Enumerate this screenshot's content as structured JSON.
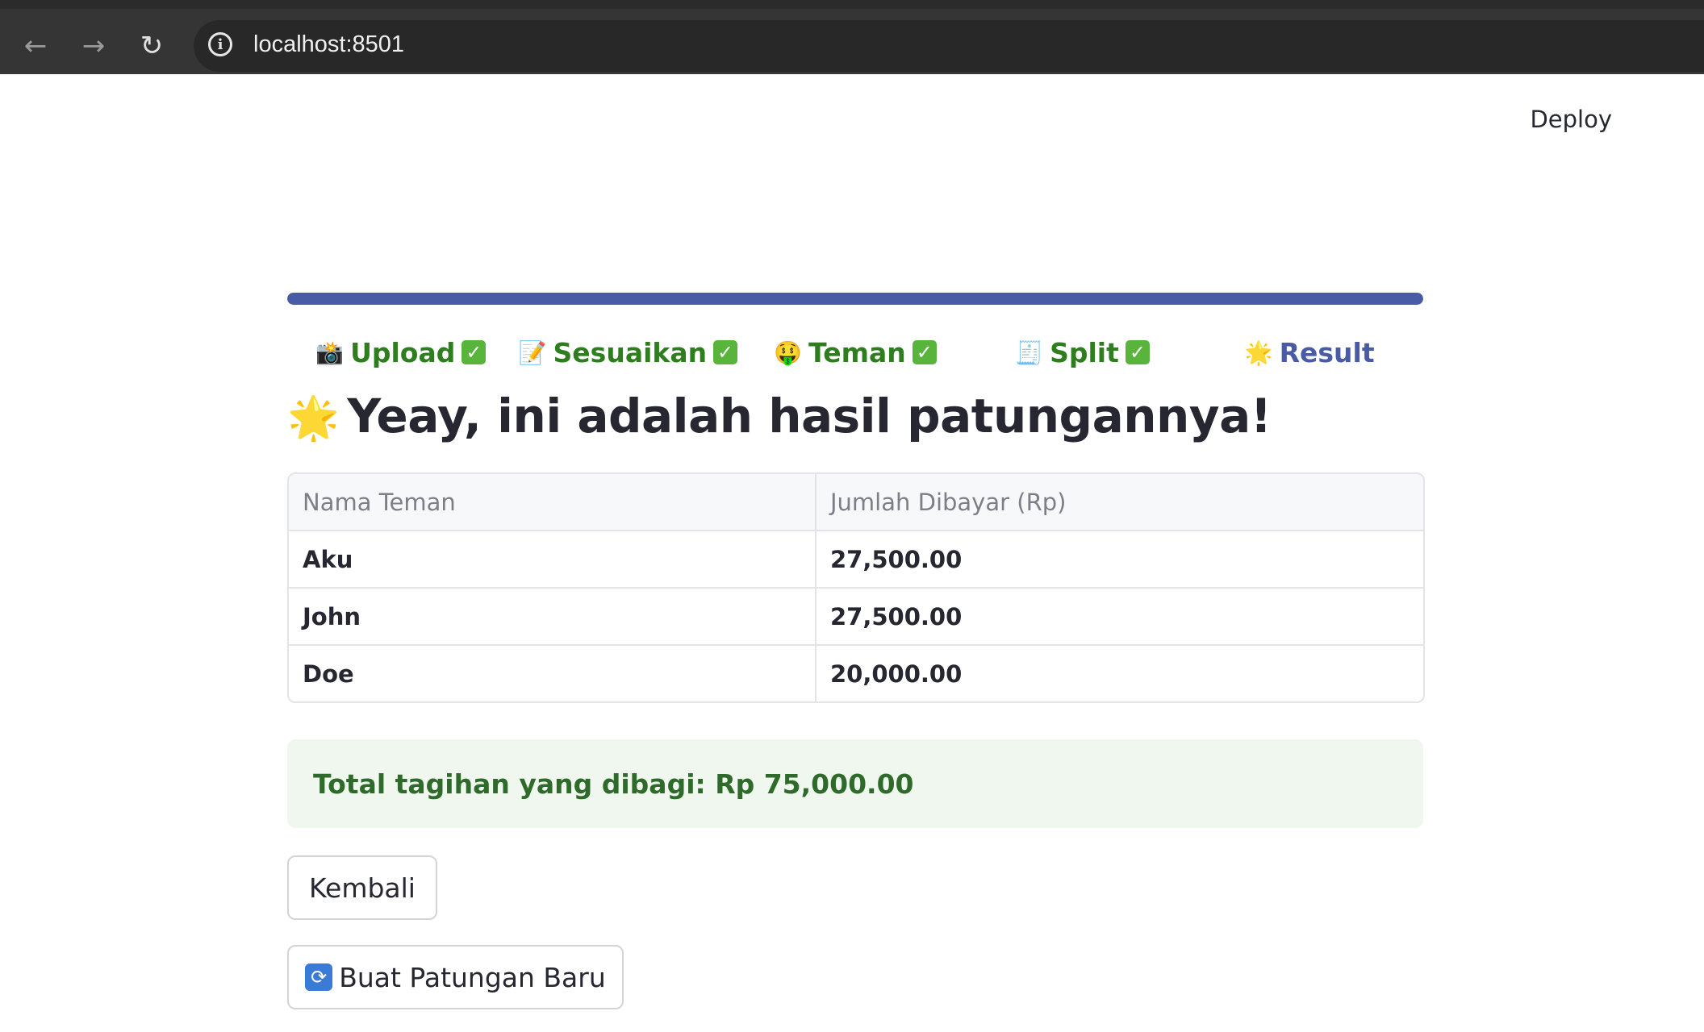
{
  "browser": {
    "url": "localhost:8501",
    "back_icon": "←",
    "forward_icon": "→",
    "reload_icon": "↻",
    "info_icon": "i"
  },
  "header": {
    "deploy_label": "Deploy"
  },
  "progress": {
    "fraction": 1.0,
    "color": "#4a5ba5"
  },
  "steps": [
    {
      "emoji": "📸",
      "label": "Upload",
      "done": true
    },
    {
      "emoji": "📝",
      "label": "Sesuaikan",
      "done": true
    },
    {
      "emoji": "🤑",
      "label": "Teman",
      "done": true
    },
    {
      "emoji": "🧾",
      "label": "Split",
      "done": true
    },
    {
      "emoji": "🌟",
      "label": "Result",
      "done": false
    }
  ],
  "title": {
    "emoji": "🌟",
    "text": "Yeay, ini adalah hasil patungannya!"
  },
  "table": {
    "headers": [
      "Nama Teman",
      "Jumlah Dibayar (Rp)"
    ],
    "rows": [
      [
        "Aku",
        "27,500.00"
      ],
      [
        "John",
        "27,500.00"
      ],
      [
        "Doe",
        "20,000.00"
      ]
    ]
  },
  "total": {
    "text": "Total tagihan yang dibagi: Rp 75,000.00"
  },
  "buttons": {
    "back_label": "Kembali",
    "new_emoji": "🔄",
    "new_label": "Buat Patungan Baru"
  },
  "colors": {
    "accent": "#4a5ba5",
    "done_green": "#2e7d1f",
    "success_bg": "#eff7ee"
  }
}
